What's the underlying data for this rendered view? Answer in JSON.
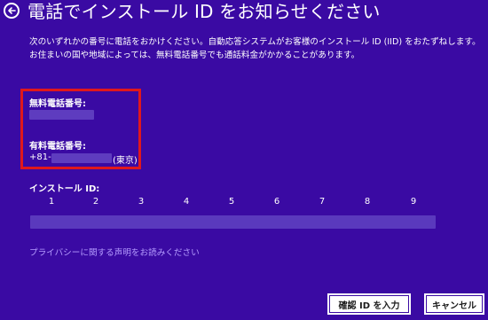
{
  "header": {
    "title": "電話でインストール ID をお知らせください",
    "back_icon": "back-arrow-circle-icon"
  },
  "description": {
    "line1": "次のいずれかの番号に電話をおかけください。自動応答システムがお客様のインストール ID (IID) をおたずねします。",
    "line2": "お住まいの国や地域によっては、無料電話番号でも通話料金がかかることがあります。"
  },
  "phone": {
    "free_label": "無料電話番号:",
    "paid_label": "有料電話番号:",
    "paid_prefix": "+81-",
    "paid_suffix": "(東京)",
    "highlight_color": "#e0181c"
  },
  "install_id": {
    "label": "インストール ID:",
    "groups": [
      "1",
      "2",
      "3",
      "4",
      "5",
      "6",
      "7",
      "8",
      "9"
    ]
  },
  "privacy_link": "プライバシーに関する声明をお読みください",
  "buttons": {
    "enter_id": "確認 ID を入力",
    "cancel": "キャンセル"
  },
  "colors": {
    "background": "#3a0aa3",
    "link": "#b59cff"
  }
}
